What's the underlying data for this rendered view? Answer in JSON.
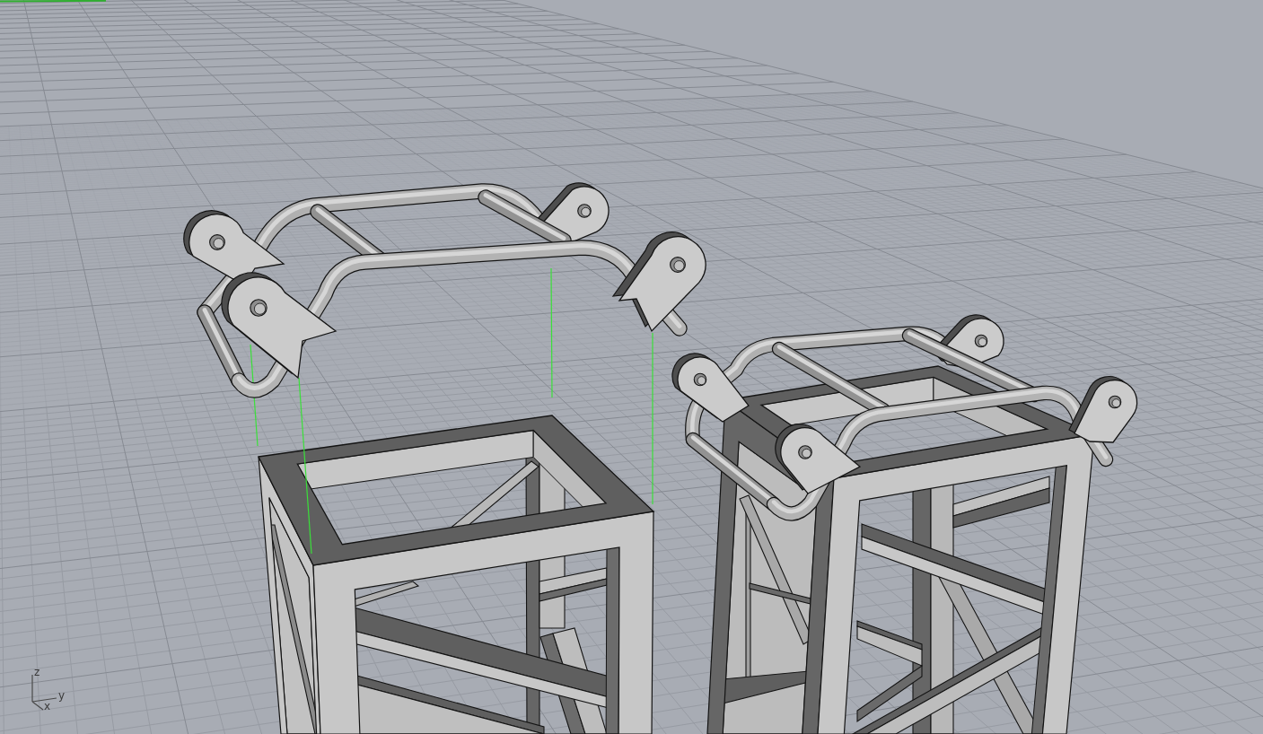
{
  "viewport": {
    "axis_labels": [
      "z",
      "y",
      "x"
    ]
  }
}
